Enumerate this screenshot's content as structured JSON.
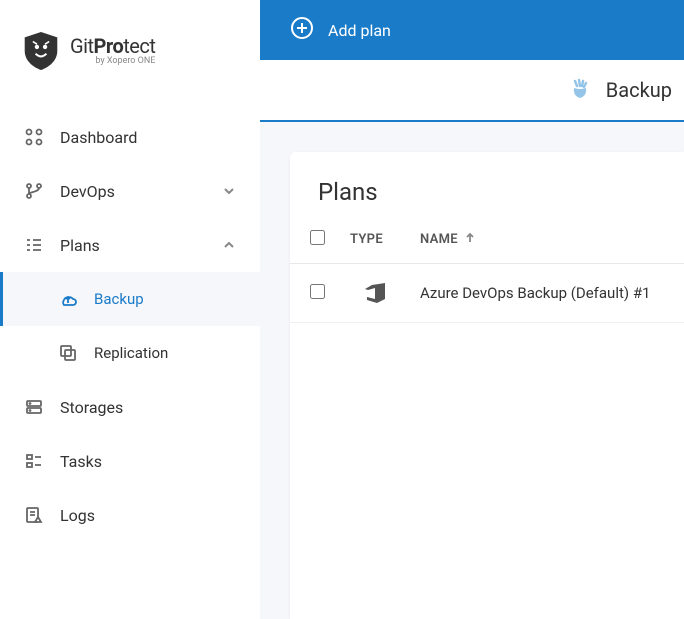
{
  "brand": {
    "prefix": "Git",
    "bold1": "Pro",
    "rest": "tect",
    "sub": "by Xopero ONE"
  },
  "sidebar": {
    "items": [
      {
        "label": "Dashboard"
      },
      {
        "label": "DevOps"
      },
      {
        "label": "Plans"
      },
      {
        "label": "Backup"
      },
      {
        "label": "Replication"
      },
      {
        "label": "Storages"
      },
      {
        "label": "Tasks"
      },
      {
        "label": "Logs"
      }
    ]
  },
  "topbar": {
    "add_plan": "Add plan"
  },
  "breadcrumb": {
    "current": "Backup"
  },
  "panel": {
    "title": "Plans",
    "columns": {
      "type": "TYPE",
      "name": "NAME"
    },
    "rows": [
      {
        "name": "Azure DevOps Backup (Default) #1"
      }
    ]
  }
}
